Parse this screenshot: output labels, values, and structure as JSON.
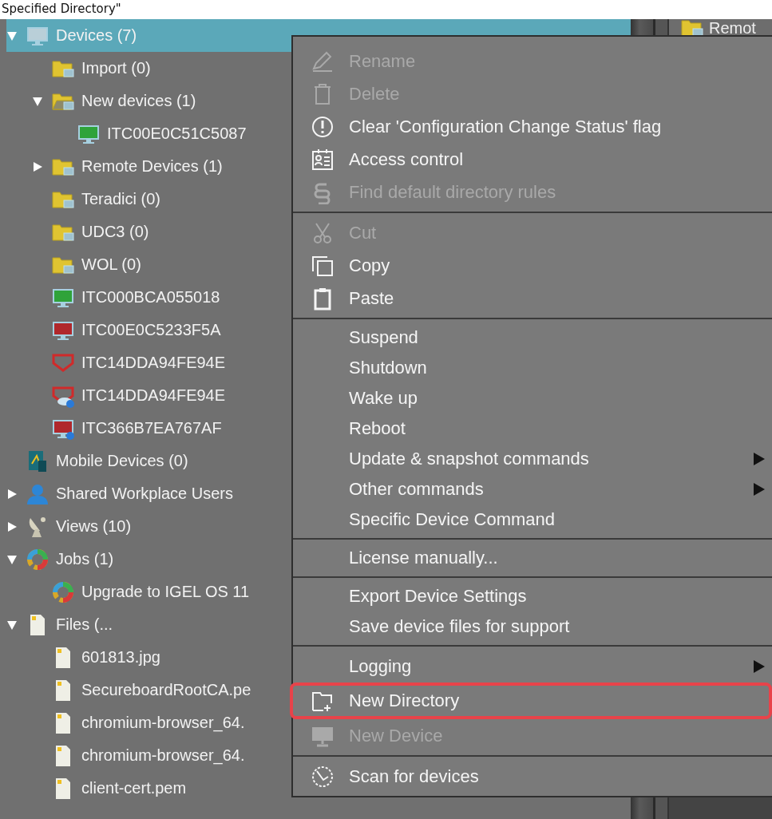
{
  "header": {
    "title": "Specified Directory\""
  },
  "tree": [
    {
      "label": "Devices (7)",
      "kind": "monitor",
      "color": "#b9cfd8",
      "selected": true,
      "expanded": true,
      "children": [
        {
          "label": "Import (0)",
          "kind": "folder",
          "selected": false
        },
        {
          "label": "New devices (1)",
          "kind": "folder-open",
          "selected": false,
          "expanded": true,
          "children": [
            {
              "label": "ITC00E0C51C5087",
              "kind": "monitor",
              "color": "#2fa33a",
              "selected": false
            }
          ]
        },
        {
          "label": "Remote Devices (1)",
          "kind": "folder",
          "selected": false,
          "expanded": false
        },
        {
          "label": "Teradici (0)",
          "kind": "folder",
          "selected": false
        },
        {
          "label": "UDC3 (0)",
          "kind": "folder",
          "selected": false
        },
        {
          "label": "WOL (0)",
          "kind": "folder",
          "selected": false
        },
        {
          "label": "ITC000BCA055018",
          "kind": "monitor",
          "color": "#2fa33a",
          "selected": false
        },
        {
          "label": "ITC00E0C5233F5A",
          "kind": "monitor",
          "color": "#b0282c",
          "selected": false
        },
        {
          "label": "ITC14DDA94FE94E",
          "kind": "udc",
          "selected": false
        },
        {
          "label": "ITC14DDA94FE94E",
          "kind": "udc-cloud",
          "selected": false
        },
        {
          "label": "ITC366B7EA767AF",
          "kind": "monitor-info",
          "color": "#b0282c",
          "selected": false
        }
      ]
    },
    {
      "label": "Mobile Devices (0)",
      "kind": "mobile",
      "selected": false
    },
    {
      "label": "Shared Workplace Users",
      "kind": "user",
      "selected": false,
      "expanded": false
    },
    {
      "label": "Views (10)",
      "kind": "dish",
      "selected": false,
      "expanded": false
    },
    {
      "label": "Jobs (1)",
      "kind": "gear",
      "selected": false,
      "expanded": true,
      "children": [
        {
          "label": "Upgrade to IGEL OS 11",
          "kind": "gear",
          "selected": false
        }
      ]
    },
    {
      "label": "Files (...",
      "kind": "file",
      "selected": false,
      "expanded": true,
      "children": [
        {
          "label": "601813.jpg",
          "kind": "file",
          "selected": false
        },
        {
          "label": "SecureboardRootCA.pe",
          "kind": "file",
          "selected": false
        },
        {
          "label": "chromium-browser_64.",
          "kind": "file",
          "selected": false
        },
        {
          "label": "chromium-browser_64.",
          "kind": "file",
          "selected": false
        },
        {
          "label": "client-cert.pem",
          "kind": "file",
          "selected": false
        }
      ]
    }
  ],
  "right_pane": {
    "items": [
      {
        "label": "Remot",
        "kind": "folder"
      }
    ]
  },
  "context_menu": {
    "groups": [
      {
        "items": [
          {
            "label": "Rename",
            "kind": "pencil",
            "disabled": true
          },
          {
            "label": "Delete",
            "kind": "trash",
            "disabled": true
          },
          {
            "label": "Clear 'Configuration Change Status' flag",
            "kind": "exclamation",
            "disabled": false
          },
          {
            "label": "Access control",
            "kind": "id-card",
            "disabled": false
          },
          {
            "label": "Find default directory rules",
            "kind": "section",
            "disabled": true
          }
        ]
      },
      {
        "items": [
          {
            "label": "Cut",
            "kind": "scissors",
            "disabled": true
          },
          {
            "label": "Copy",
            "kind": "copy",
            "disabled": false
          },
          {
            "label": "Paste",
            "kind": "clipboard",
            "disabled": false
          }
        ]
      },
      {
        "items": [
          {
            "label": "Suspend",
            "disabled": false
          },
          {
            "label": "Shutdown",
            "disabled": false
          },
          {
            "label": "Wake up",
            "disabled": false
          },
          {
            "label": "Reboot",
            "disabled": false
          },
          {
            "label": "Update & snapshot commands",
            "disabled": false,
            "submenu": true
          },
          {
            "label": "Other commands",
            "disabled": false,
            "submenu": true
          },
          {
            "label": "Specific Device Command",
            "disabled": false
          }
        ]
      },
      {
        "items": [
          {
            "label": "License manually...",
            "disabled": false
          }
        ]
      },
      {
        "items": [
          {
            "label": "Export Device Settings",
            "disabled": false
          },
          {
            "label": "Save device files for support",
            "disabled": false
          }
        ]
      },
      {
        "items": [
          {
            "label": "Logging",
            "disabled": false,
            "submenu": true
          },
          {
            "label": "New Directory",
            "kind": "folder-plus",
            "disabled": false,
            "highlighted": true
          },
          {
            "label": "New Device",
            "kind": "monitor",
            "disabled": true
          }
        ]
      },
      {
        "items": [
          {
            "label": "Scan for devices",
            "kind": "radar",
            "disabled": false
          }
        ]
      }
    ]
  }
}
